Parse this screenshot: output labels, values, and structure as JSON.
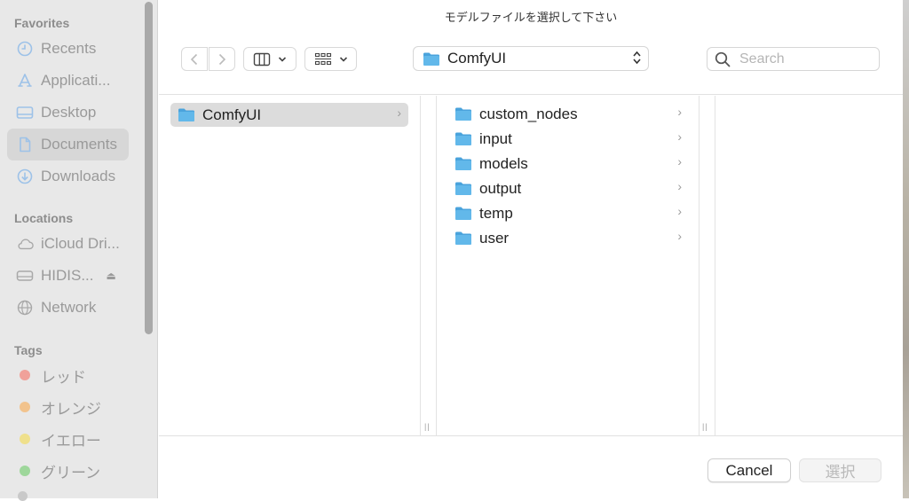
{
  "dialog": {
    "title": "モデルファイルを選択して下さい"
  },
  "sidebar": {
    "favorites_label": "Favorites",
    "favorites": [
      {
        "label": "Recents",
        "icon": "clock-icon"
      },
      {
        "label": "Applicati...",
        "icon": "applications-icon"
      },
      {
        "label": "Desktop",
        "icon": "desktop-icon"
      },
      {
        "label": "Documents",
        "icon": "document-icon",
        "selected": true
      },
      {
        "label": "Downloads",
        "icon": "download-icon"
      }
    ],
    "locations_label": "Locations",
    "locations": [
      {
        "label": "iCloud Dri...",
        "icon": "cloud-icon"
      },
      {
        "label": "HIDIS...",
        "icon": "drive-icon",
        "eject": "⏏"
      },
      {
        "label": "Network",
        "icon": "globe-icon"
      }
    ],
    "tags_label": "Tags",
    "tags": [
      {
        "label": "レッド",
        "color": "#f0a19a"
      },
      {
        "label": "オレンジ",
        "color": "#f2c38d"
      },
      {
        "label": "イエロー",
        "color": "#efe08c"
      },
      {
        "label": "グリーン",
        "color": "#9ed79b"
      }
    ]
  },
  "toolbar": {
    "path_label": "ComfyUI",
    "search_placeholder": "Search"
  },
  "columns": {
    "first": [
      {
        "label": "ComfyUI",
        "selected": true
      }
    ],
    "second": [
      {
        "label": "custom_nodes"
      },
      {
        "label": "input"
      },
      {
        "label": "models"
      },
      {
        "label": "output"
      },
      {
        "label": "temp"
      },
      {
        "label": "user"
      }
    ]
  },
  "footer": {
    "cancel_label": "Cancel",
    "choose_label": "選択"
  },
  "colors": {
    "folder": "#62b8ea",
    "folder_tab": "#4aa3dc",
    "sidebar_icon": "#9dc2e8"
  }
}
